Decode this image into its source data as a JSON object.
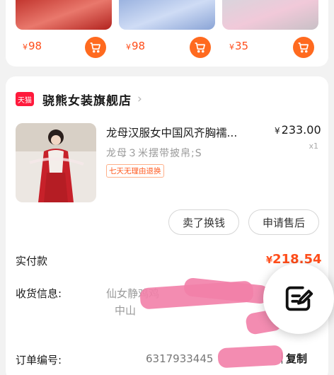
{
  "recommendations": [
    {
      "currency": "¥",
      "price": "98"
    },
    {
      "currency": "¥",
      "price": "98"
    },
    {
      "currency": "¥",
      "price": "35"
    }
  ],
  "shop": {
    "badge": "天猫",
    "name": "骁熊女装旗舰店",
    "arrow": "›"
  },
  "product": {
    "title": "龙母汉服女中国风齐胸襦...",
    "currency": "¥",
    "price": "233.00",
    "sku": "龙母３米摆带披帛;S",
    "quantity": "x1",
    "tag": "七天无理由退换"
  },
  "actions": {
    "sell_label": "卖了换钱",
    "after_sale_label": "申请售后"
  },
  "payment": {
    "label": "实付款",
    "currency": "¥",
    "amount": "218.54"
  },
  "shipping": {
    "label": "收货信息:",
    "name": "仙女静鸡鸡",
    "address": "中山"
  },
  "order": {
    "label": "订单编号:",
    "number": "6317933445",
    "copy_label": "复制"
  },
  "colors": {
    "accent": "#ff4d1a",
    "tmall_red": "#ff1a3c",
    "redaction": "#f27fa8"
  },
  "icons": {
    "cart": "cart-icon",
    "fab": "edit-note-icon"
  }
}
